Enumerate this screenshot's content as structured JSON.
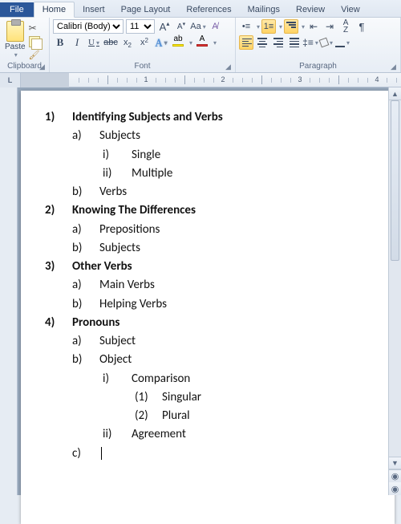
{
  "tabs": {
    "file": "File",
    "home": "Home",
    "insert": "Insert",
    "page_layout": "Page Layout",
    "references": "References",
    "mailings": "Mailings",
    "review": "Review",
    "view": "View"
  },
  "ribbon": {
    "clipboard": {
      "label": "Clipboard",
      "paste": "Paste"
    },
    "font": {
      "label": "Font",
      "family": "Calibri (Body)",
      "size": "11"
    },
    "paragraph": {
      "label": "Paragraph"
    }
  },
  "ruler": {
    "corner": "L",
    "marks": [
      "1",
      "2",
      "3",
      "4"
    ]
  },
  "outline": [
    {
      "n": "1)",
      "t": "Identifying Subjects and Verbs",
      "c": [
        {
          "n": "a)",
          "t": "Subjects",
          "c": [
            {
              "n": "i)",
              "t": "Single"
            },
            {
              "n": "ii)",
              "t": "Multiple"
            }
          ]
        },
        {
          "n": "b)",
          "t": "Verbs"
        }
      ]
    },
    {
      "n": "2)",
      "t": "Knowing The Differences",
      "c": [
        {
          "n": "a)",
          "t": "Prepositions"
        },
        {
          "n": "b)",
          "t": "Subjects"
        }
      ]
    },
    {
      "n": "3)",
      "t": "Other Verbs",
      "c": [
        {
          "n": "a)",
          "t": "Main Verbs"
        },
        {
          "n": "b)",
          "t": "Helping Verbs"
        }
      ]
    },
    {
      "n": "4)",
      "t": "Pronouns",
      "c": [
        {
          "n": "a)",
          "t": "Subject"
        },
        {
          "n": "b)",
          "t": "Object",
          "c": [
            {
              "n": "i)",
              "t": "Comparison",
              "c": [
                {
                  "n": "(1)",
                  "t": "Singular"
                },
                {
                  "n": "(2)",
                  "t": "Plural"
                }
              ]
            },
            {
              "n": "ii)",
              "t": "Agreement"
            }
          ]
        },
        {
          "n": "c)",
          "t": ""
        }
      ]
    }
  ]
}
